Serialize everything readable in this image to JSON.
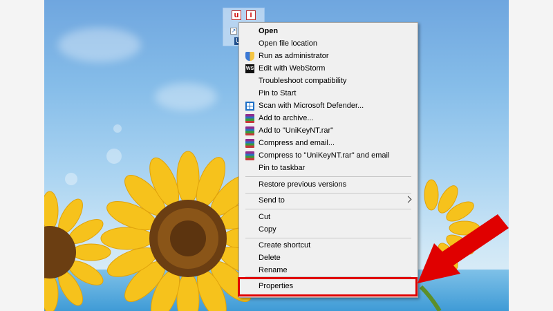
{
  "desktop": {
    "shortcut_label": "U",
    "shortcut_icon_letter_1": "u",
    "shortcut_icon_letter_2": "i"
  },
  "context_menu": {
    "items": [
      {
        "label": "Open",
        "icon": "",
        "bold": true
      },
      {
        "label": "Open file location",
        "icon": ""
      },
      {
        "label": "Run as administrator",
        "icon": "shield-icon"
      },
      {
        "label": "Edit with WebStorm",
        "icon": "webstorm-icon"
      },
      {
        "label": "Troubleshoot compatibility",
        "icon": ""
      },
      {
        "label": "Pin to Start",
        "icon": ""
      },
      {
        "label": "Scan with Microsoft Defender...",
        "icon": "defender-icon"
      },
      {
        "label": "Add to archive...",
        "icon": "winrar-icon"
      },
      {
        "label": "Add to \"UniKeyNT.rar\"",
        "icon": "winrar-icon"
      },
      {
        "label": "Compress and email...",
        "icon": "winrar-icon"
      },
      {
        "label": "Compress to \"UniKeyNT.rar\" and email",
        "icon": "winrar-icon"
      },
      {
        "label": "Pin to taskbar",
        "icon": ""
      },
      {
        "label": "Restore previous versions",
        "icon": ""
      },
      {
        "label": "Send to",
        "icon": "",
        "submenu": true
      },
      {
        "label": "Cut",
        "icon": ""
      },
      {
        "label": "Copy",
        "icon": ""
      },
      {
        "label": "Create shortcut",
        "icon": ""
      },
      {
        "label": "Delete",
        "icon": ""
      },
      {
        "label": "Rename",
        "icon": ""
      },
      {
        "label": "Properties",
        "icon": "",
        "highlighted": true
      }
    ]
  },
  "colors": {
    "highlight_border": "#e00000",
    "arrow": "#e00000",
    "menu_background": "#f0f0f0"
  }
}
